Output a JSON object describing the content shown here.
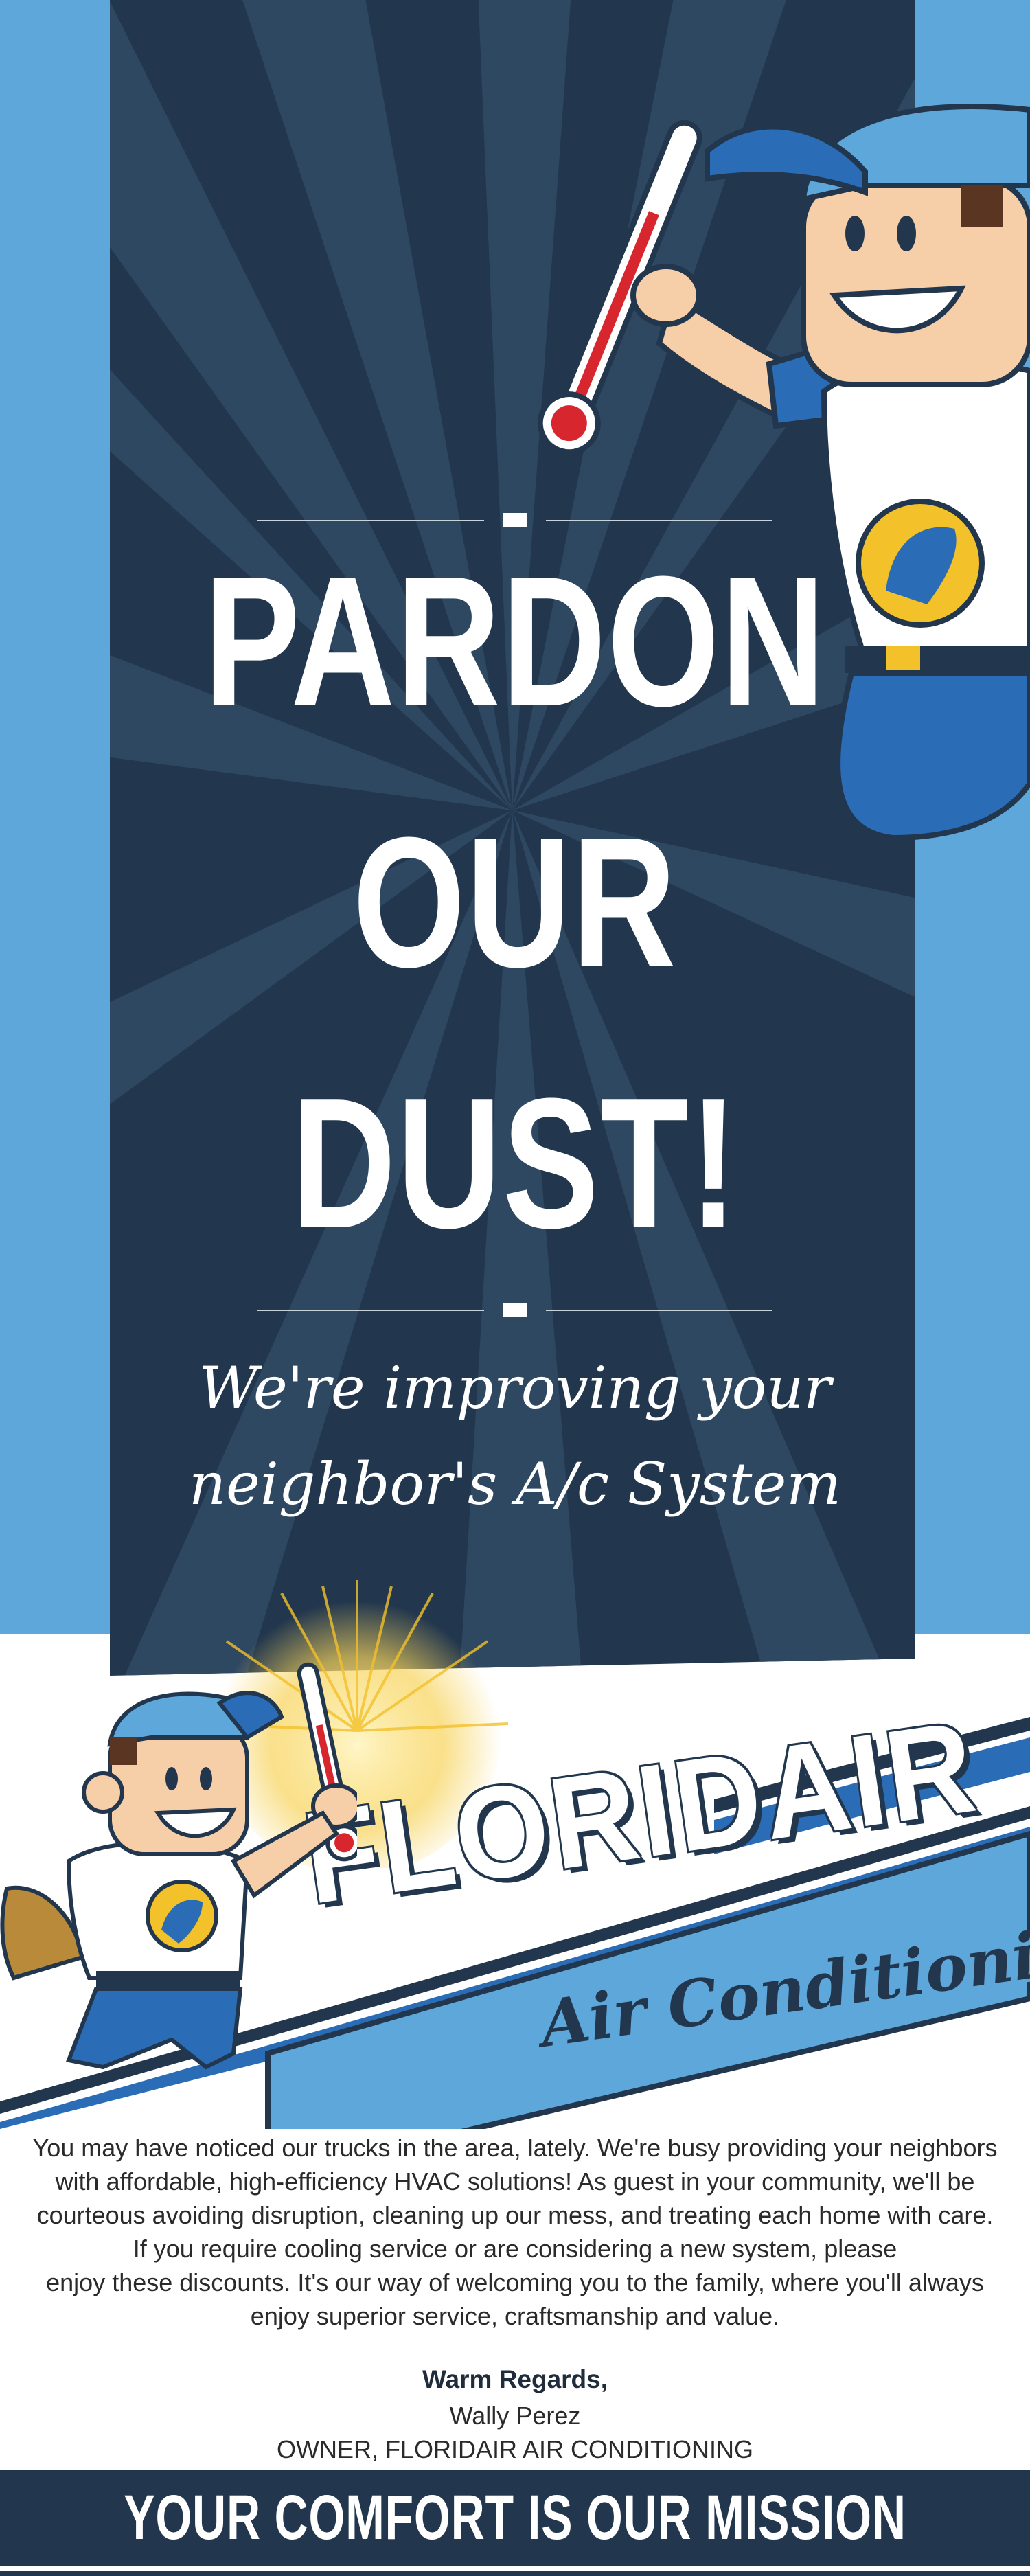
{
  "hero": {
    "headline_line1": "PARDON",
    "headline_line2": "OUR",
    "headline_line3": "DUST!",
    "script_line1": "We're improving your",
    "script_line2": "neighbor's A/c System"
  },
  "logo": {
    "brand": "FLORIDAIR",
    "tagline": "Air Conditioning"
  },
  "letter": {
    "lines": [
      "You may have noticed our trucks in the area, lately. We're busy providing your neighbors",
      "with affordable, high-efficiency HVAC solutions! As guest in your community, we'll be",
      "courteous avoiding disruption, cleaning up our mess, and treating each home with care.",
      "If you require cooling service or are considering a new system, please",
      "enjoy these discounts. It's our way of welcoming you to the family, where you'll always",
      "enjoy superior service, craftsmanship and value."
    ],
    "closing": "Warm Regards,",
    "signer_name": "Wally Perez",
    "signer_title": "OWNER, FLORIDAIR AIR CONDITIONING"
  },
  "footer": {
    "slogan": "YOUR COMFORT IS OUR MISSION"
  },
  "colors": {
    "navy": "#22374e",
    "sky_blue": "#5da7db",
    "brand_blue": "#2a6cb5",
    "thermometer_red": "#d7262e",
    "mascot_yellow": "#f3c12a"
  },
  "icons": [
    "thermometer-icon",
    "mascot-illustration",
    "sunburst-icon"
  ]
}
